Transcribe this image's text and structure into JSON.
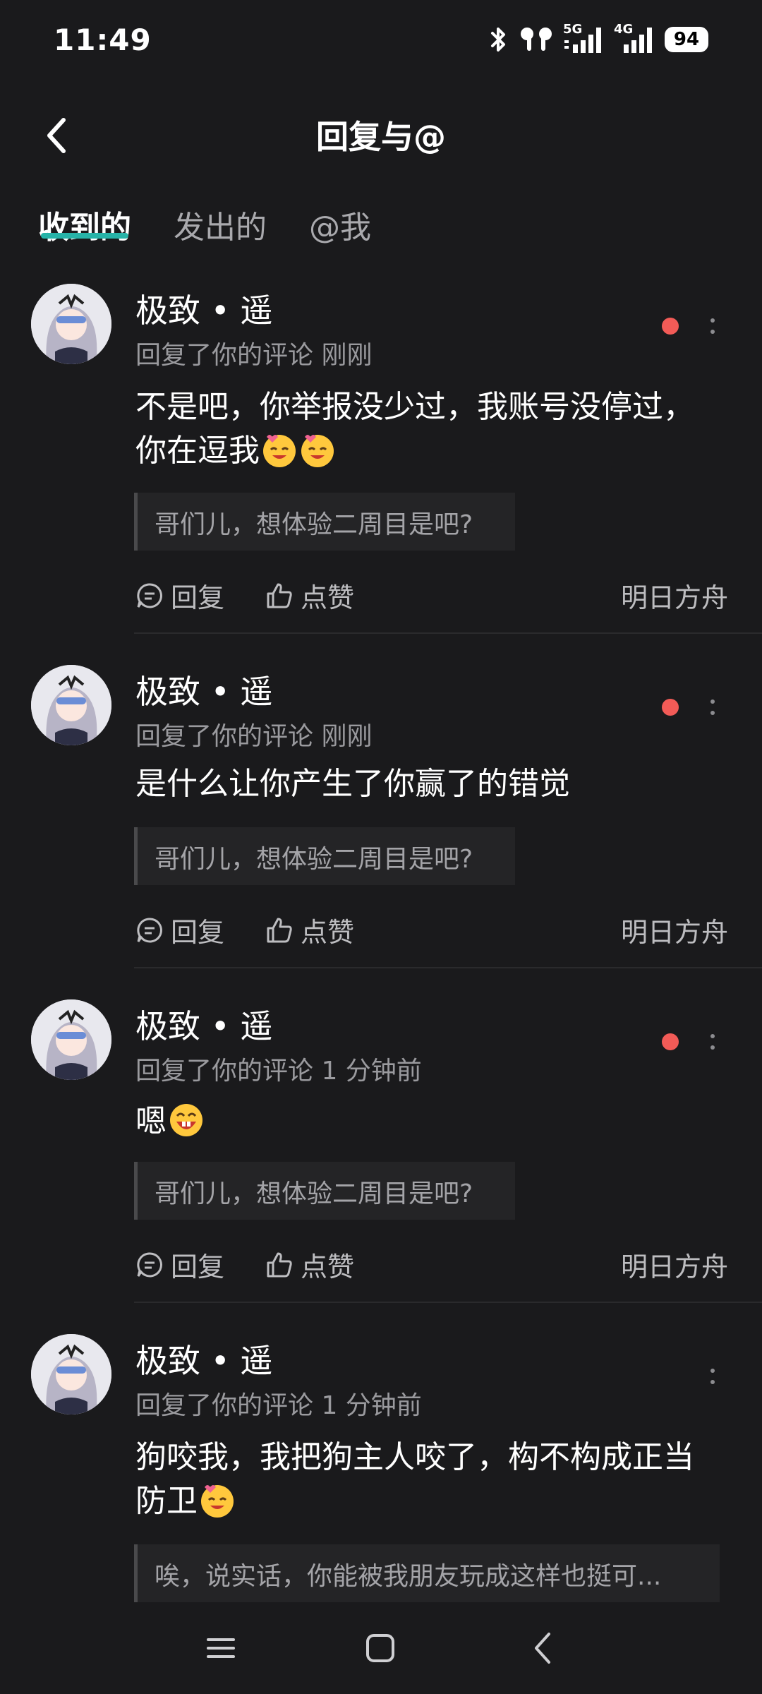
{
  "status_bar": {
    "time": "11:49",
    "signal_1_label": "5G",
    "signal_2_label": "4G",
    "battery": "94",
    "icons": [
      "bluetooth-icon",
      "earbuds-icon",
      "signal-5g-icon",
      "signal-4g-icon",
      "battery-icon"
    ]
  },
  "header": {
    "title": "回复与@"
  },
  "tabs": [
    {
      "label": "收到的",
      "active": true
    },
    {
      "label": "发出的",
      "active": false
    },
    {
      "label": "@我",
      "active": false
    }
  ],
  "comments": [
    {
      "name": "极致 • 遥",
      "meta": "回复了你的评论 刚刚",
      "text_1": "不是吧，你举报没少过，我账号没停过，",
      "text_2": "你在逗我",
      "quote": "哥们儿，想体验二周目是吧?",
      "reply_label": "回复",
      "like_label": "点赞",
      "source": "明日方舟",
      "unread": true
    },
    {
      "name": "极致 • 遥",
      "meta": "回复了你的评论 刚刚",
      "text_1": "是什么让你产生了你赢了的错觉",
      "quote": "哥们儿，想体验二周目是吧?",
      "reply_label": "回复",
      "like_label": "点赞",
      "source": "明日方舟",
      "unread": true
    },
    {
      "name": "极致 • 遥",
      "meta": "回复了你的评论 1 分钟前",
      "text_1": "嗯",
      "quote": "哥们儿，想体验二周目是吧?",
      "reply_label": "回复",
      "like_label": "点赞",
      "source": "明日方舟",
      "unread": true
    },
    {
      "name": "极致 • 遥",
      "meta": "回复了你的评论 1 分钟前",
      "text_1": "狗咬我，我把狗主人咬了，构不构成正当",
      "text_2": "防卫",
      "quote": "唉，说实话，你能被我朋友玩成这样也挺可...",
      "unread": false
    }
  ],
  "colors": {
    "background": "#1a1a1c",
    "accent": "#27b3a8",
    "unread_dot": "#f25b57",
    "secondary_text": "#9a9a9e"
  }
}
